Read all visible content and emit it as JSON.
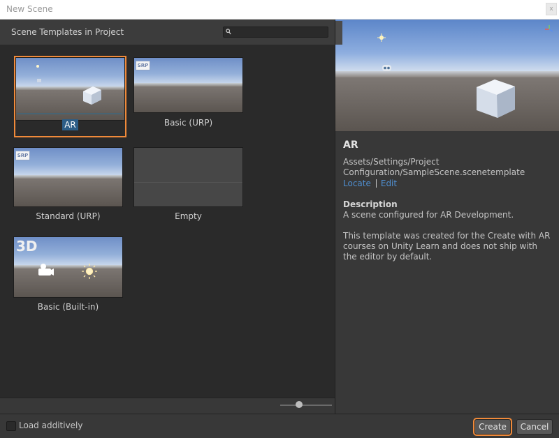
{
  "window": {
    "title": "New Scene",
    "close_glyph": "x"
  },
  "left_panel": {
    "heading": "Scene Templates in Project",
    "search": {
      "value": "",
      "placeholder": ""
    }
  },
  "templates": [
    {
      "label": "AR",
      "selected": true,
      "thumb": "ar"
    },
    {
      "label": "Basic (URP)",
      "selected": false,
      "thumb": "srp",
      "badge": "SRP"
    },
    {
      "label": "Standard (URP)",
      "selected": false,
      "thumb": "srp",
      "badge": "SRP"
    },
    {
      "label": "Empty",
      "selected": false,
      "thumb": "empty"
    },
    {
      "label": "Basic (Built-in)",
      "selected": false,
      "thumb": "builtin",
      "badge": "3D"
    }
  ],
  "details": {
    "name": "AR",
    "path": "Assets/Settings/Project Configuration/SampleScene.scenetemplate",
    "locate_label": "Locate",
    "edit_label": "Edit",
    "description_heading": "Description",
    "description": "A scene configured for AR Development.",
    "note": "This template was created for the Create with AR courses on Unity Learn and does not ship with the editor by default."
  },
  "footer": {
    "load_additively_label": "Load additively",
    "load_additively_checked": false,
    "create_label": "Create",
    "cancel_label": "Cancel"
  },
  "colors": {
    "selection_outline": "#f08a3a",
    "selected_label_bg": "#2c5d87",
    "link": "#4f8fd1"
  }
}
